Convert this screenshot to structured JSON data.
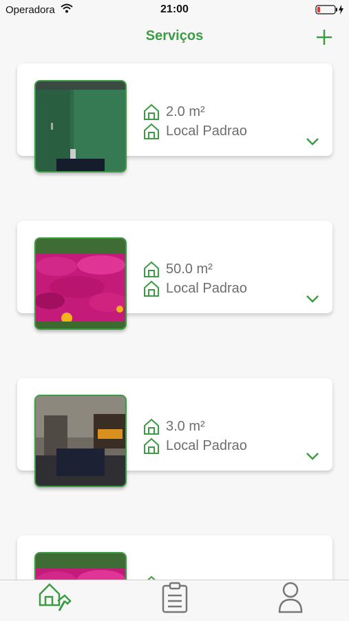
{
  "status_bar": {
    "carrier": "Operadora",
    "time": "21:00"
  },
  "header": {
    "title": "Serviços",
    "add_icon": "plus-icon"
  },
  "services": [
    {
      "area": "2.0 m²",
      "location": "Local Padrao",
      "photo": "green-wall-room"
    },
    {
      "area": "50.0 m²",
      "location": "Local Padrao",
      "photo": "pink-flowers"
    },
    {
      "area": "3.0 m²",
      "location": "Local Padrao",
      "photo": "dim-room-window"
    },
    {
      "area": "",
      "location": "",
      "photo": "pink-flowers"
    }
  ],
  "tab_bar": {
    "items": [
      {
        "icon": "home-hammer-icon",
        "active": true
      },
      {
        "icon": "clipboard-icon",
        "active": false
      },
      {
        "icon": "person-icon",
        "active": false
      }
    ]
  },
  "colors": {
    "accent": "#3d9a45",
    "text_secondary": "#6e6e6e",
    "background": "#f7f7f7"
  }
}
